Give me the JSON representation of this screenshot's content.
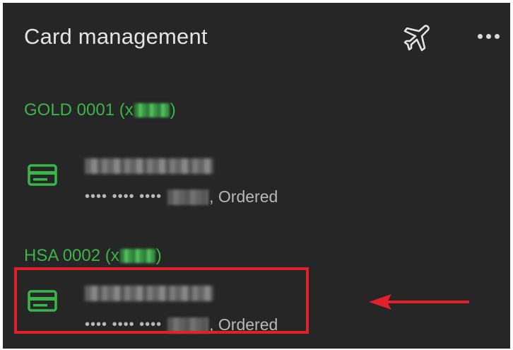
{
  "header": {
    "title": "Card management"
  },
  "icons": {
    "airplane": "airplane-icon",
    "more": "more-options-icon",
    "card": "credit-card-icon"
  },
  "colors": {
    "background": "#262626",
    "accent_green": "#39b54a",
    "annotation_red": "#e0202a"
  },
  "accounts": [
    {
      "title_prefix": "GOLD 0001 (x",
      "title_suffix": ")",
      "card": {
        "masked_digits": "•••• •••• ••••",
        "status": ", Ordered"
      }
    },
    {
      "title_prefix": "HSA 0002 (x",
      "title_suffix": ")",
      "card": {
        "masked_digits": "•••• •••• ••••",
        "status": ", Ordered"
      }
    }
  ]
}
